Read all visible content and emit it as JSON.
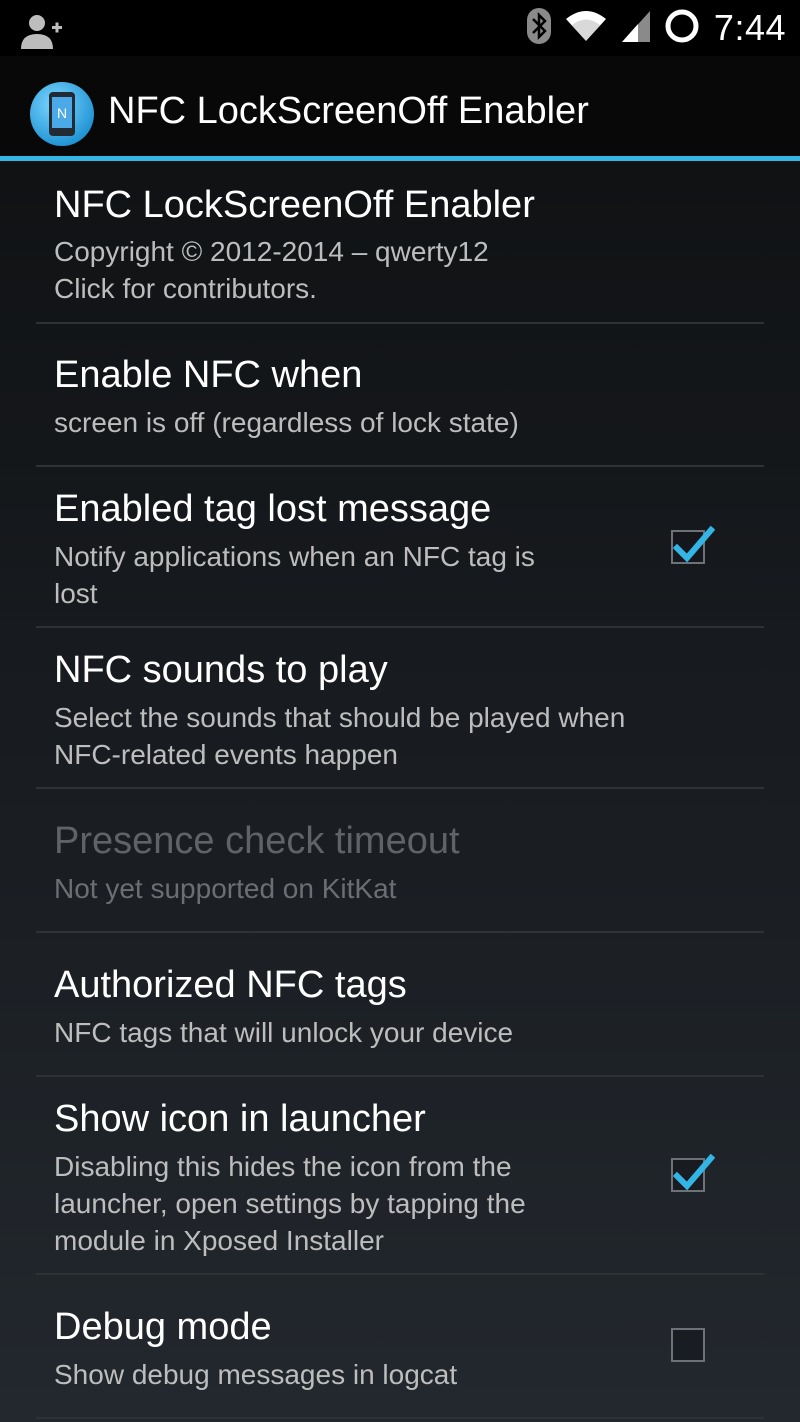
{
  "status_bar": {
    "time": "7:44",
    "icons": [
      "add-user-icon",
      "bluetooth-icon",
      "wifi-icon",
      "signal-icon",
      "sync-icon"
    ]
  },
  "action_bar": {
    "title": "NFC LockScreenOff Enabler",
    "icon": "nfc-phone-app-icon",
    "accent_color": "#33b5e5"
  },
  "preferences": [
    {
      "title": "NFC LockScreenOff Enabler",
      "summary_lines": [
        "Copyright © 2012-2014 – qwerty12",
        "Click for contributors."
      ],
      "enabled": true
    },
    {
      "title": "Enable NFC when",
      "summary_lines": [
        "screen is off (regardless of lock state)"
      ],
      "enabled": true
    },
    {
      "title": "Enabled tag lost message",
      "summary_lines": [
        "Notify applications when an NFC tag is",
        "lost"
      ],
      "enabled": true,
      "checked": true
    },
    {
      "title": "NFC sounds to play",
      "summary_lines": [
        "Select the sounds that should be played when",
        "NFC-related events happen"
      ],
      "enabled": true
    },
    {
      "title": "Presence check timeout",
      "summary_lines": [
        "Not yet supported on KitKat"
      ],
      "enabled": false
    },
    {
      "title": "Authorized NFC tags",
      "summary_lines": [
        "NFC tags that will unlock your device"
      ],
      "enabled": true
    },
    {
      "title": "Show icon in launcher",
      "summary_lines": [
        "Disabling this hides the icon from the",
        "launcher, open settings by tapping the",
        "module in Xposed Installer"
      ],
      "enabled": true,
      "checked": true
    },
    {
      "title": "Debug mode",
      "summary_lines": [
        "Show debug messages in logcat"
      ],
      "enabled": true,
      "checked": false
    }
  ]
}
